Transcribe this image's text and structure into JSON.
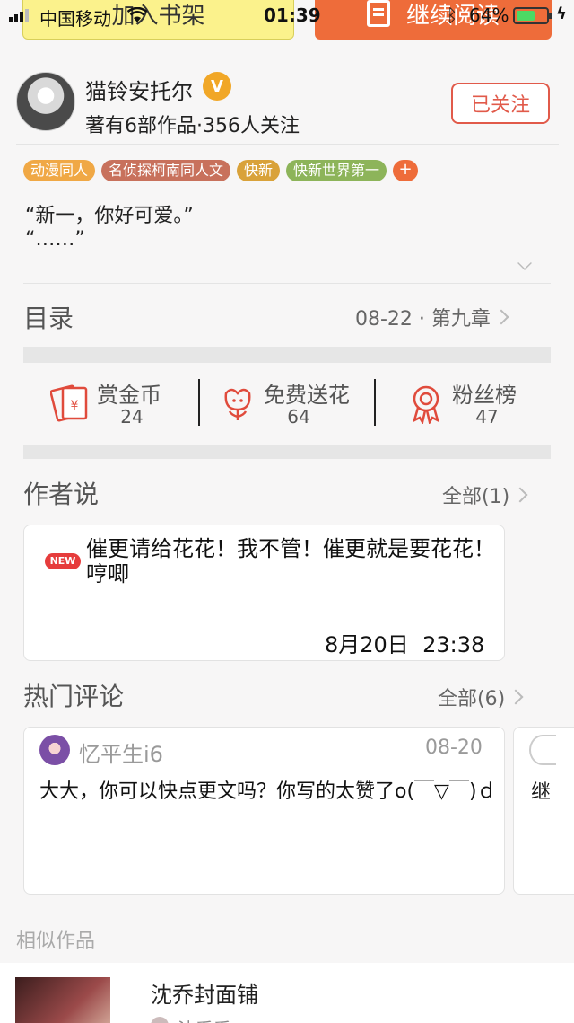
{
  "top_actions": {
    "shelf_label": "加入书架",
    "read_label": "继续阅读"
  },
  "status_bar": {
    "carrier": "中国移动",
    "time": "01:39",
    "battery": "64%",
    "battery_level": 0.64
  },
  "author": {
    "name": "猫铃安托尔",
    "meta": "著有6部作品·356人关注",
    "follow_label": "已关注"
  },
  "tags": [
    {
      "label": "动漫同人",
      "color": "#f0a845"
    },
    {
      "label": "名侦探柯南同人文",
      "color": "#c8715c"
    },
    {
      "label": "快新",
      "color": "#d9a23a"
    },
    {
      "label": "快新世界第一",
      "color": "#8db45a"
    }
  ],
  "tag_add": "+",
  "quote": {
    "line1": "“新一，你好可爱。”",
    "line2": "“……”"
  },
  "toc": {
    "title": "目录",
    "latest": "08-22 · 第九章"
  },
  "stats": [
    {
      "label": "赏金币",
      "value": "24",
      "icon": "red-envelope-icon"
    },
    {
      "label": "免费送花",
      "value": "64",
      "icon": "flower-icon"
    },
    {
      "label": "粉丝榜",
      "value": "47",
      "icon": "medal-icon"
    }
  ],
  "author_says": {
    "title": "作者说",
    "all_label": "全部(1)",
    "badge": "NEW",
    "text": "催更请给花花！我不管！催更就是要花花！哼唧",
    "time": "8月20日  23:38"
  },
  "hot_comments": {
    "title": "热门评论",
    "all_label": "全部(6)",
    "items": [
      {
        "user": "忆平生i6",
        "date": "08-20",
        "text": "大大，你可以快点更文吗？你写的太赞了o(￣▽￣)ｄ"
      },
      {
        "text": "继"
      }
    ]
  },
  "similar": {
    "label": "相似作品",
    "title": "沈乔封面铺",
    "sub": "沈乔乔"
  },
  "colors": {
    "accent": "#ee6c3a",
    "follow": "#e15a4a",
    "icon_red": "#e04b3c"
  }
}
